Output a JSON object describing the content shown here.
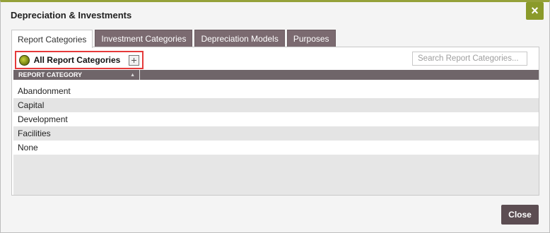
{
  "dialog": {
    "title": "Depreciation & Investments",
    "close_icon": "×",
    "close_label": "Close"
  },
  "tabs": [
    {
      "label": "Report Categories",
      "active": true
    },
    {
      "label": "Investment Categories",
      "active": false
    },
    {
      "label": "Depreciation Models",
      "active": false
    },
    {
      "label": "Purposes",
      "active": false
    }
  ],
  "toolbar": {
    "title": "All Report Categories",
    "icons": [
      "globe-icon",
      "add-icon"
    ]
  },
  "search": {
    "placeholder": "Search Report Categories..."
  },
  "grid": {
    "column_header": "REPORT CATEGORY",
    "sort_indicator": "▲",
    "rows": [
      "Abandonment",
      "Capital",
      "Development",
      "Facilities",
      "None"
    ]
  },
  "colors": {
    "accent": "#8a9a2a",
    "tab_bg": "#7b6a70",
    "header_bg": "#6f6569",
    "button_bg": "#5c4d52",
    "highlight_border": "#e53a3a"
  }
}
